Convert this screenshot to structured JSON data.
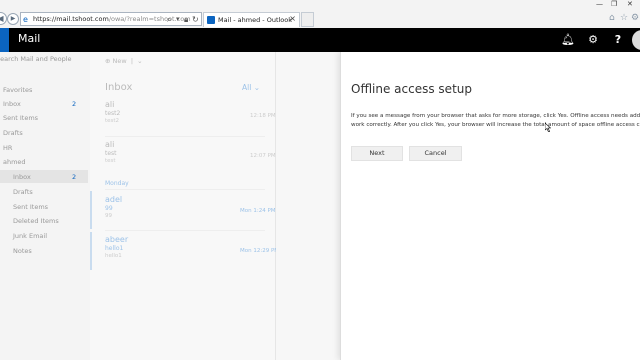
{
  "browser": {
    "url_host": "https://mail.tshoot.com",
    "url_path": "/owa/?realm=tshoot.com",
    "tab_title": "Mail - ahmed - Outlook",
    "tab_close": "×",
    "back_glyph": "◀",
    "forward_glyph": "▶"
  },
  "suite": {
    "app_name": "Mail",
    "icons": [
      "bell-icon",
      "gear-icon",
      "help-icon"
    ],
    "help_glyph": "?"
  },
  "leftnav": {
    "search_placeholder": "Search Mail and People",
    "favorites_label": "Favorites",
    "favorites": [
      {
        "label": "Inbox",
        "count": "2"
      },
      {
        "label": "Sent Items"
      },
      {
        "label": "Drafts"
      }
    ],
    "hr_label": "HR",
    "account_label": "ahmed",
    "account_folders": [
      {
        "label": "Inbox",
        "count": "2"
      },
      {
        "label": "Drafts"
      },
      {
        "label": "Sent Items"
      },
      {
        "label": "Deleted Items"
      },
      {
        "label": "Junk Email"
      },
      {
        "label": "Notes"
      }
    ]
  },
  "list": {
    "new_label": "New",
    "title": "Inbox",
    "filter_label": "All",
    "group_monday": "Monday",
    "messages": [
      {
        "from": "ali",
        "subject": "test2",
        "preview": "test2",
        "time": "12:18 PM",
        "unread": false
      },
      {
        "from": "ali",
        "subject": "test",
        "preview": "test",
        "time": "12:07 PM",
        "unread": false
      },
      {
        "from": "adel",
        "subject": "99",
        "preview": "99",
        "time": "Mon 1:24 PM",
        "unread": true
      },
      {
        "from": "abeer",
        "subject": "hello1",
        "preview": "hello1",
        "time": "Mon 12:29 PM",
        "unread": true
      }
    ]
  },
  "dialog": {
    "title": "Offline access setup",
    "line1": "If you see a message from your browser that asks for more storage, click Yes. Offline access needs additional space to",
    "line2": "work correctly. After you click Yes, your browser will increase the total amount of space offline access can take up.",
    "next_label": "Next",
    "cancel_label": "Cancel"
  }
}
